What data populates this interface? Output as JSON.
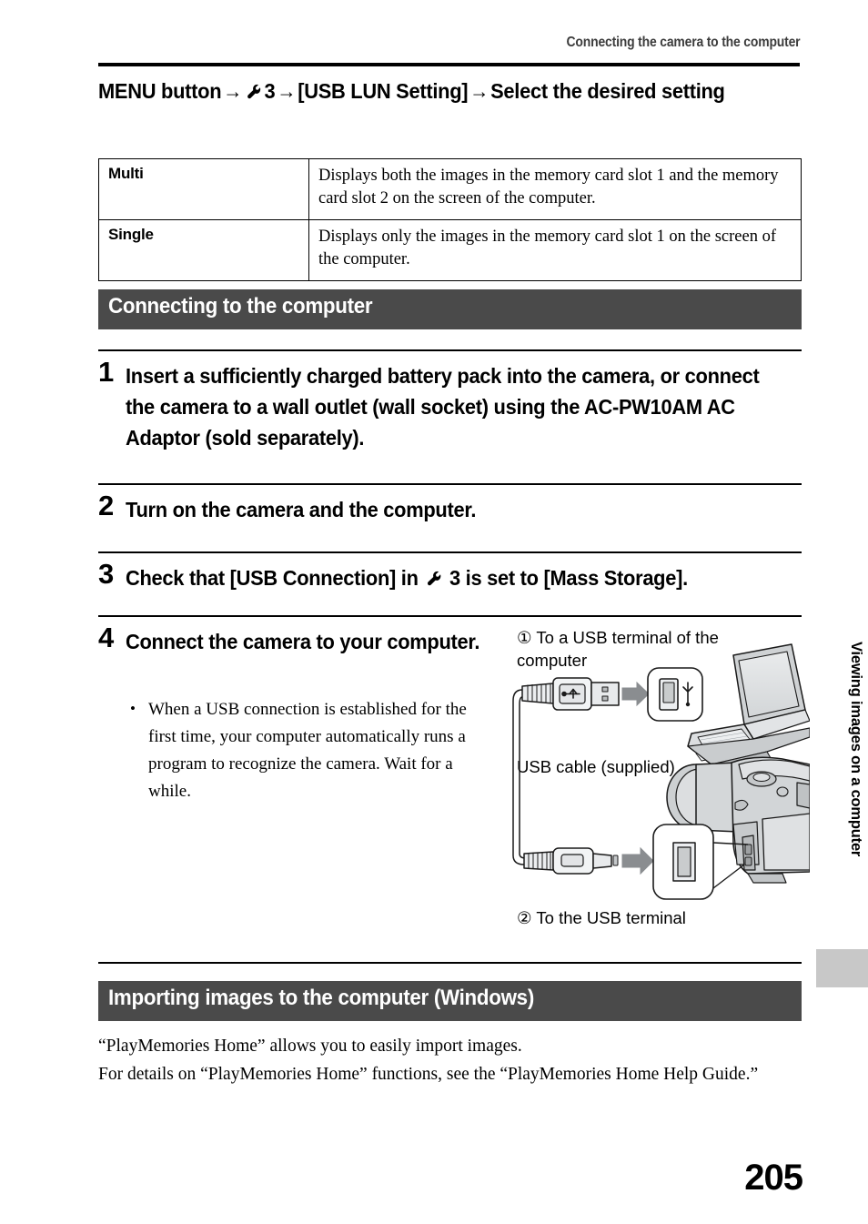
{
  "header": {
    "running_title": "Connecting the camera to the computer"
  },
  "menu_path": {
    "part1": "MENU button",
    "arrow1": "→",
    "icon": "wrench-icon",
    "tab_number": "3",
    "arrow2": "→",
    "part2": "[USB LUN Setting]",
    "arrow3": "→",
    "part3": "Select the desired setting"
  },
  "spec_table": {
    "rows": [
      {
        "term": "Multi",
        "desc": "Displays both the images in the memory card slot 1 and the memory card slot 2 on the screen of the computer."
      },
      {
        "term": "Single",
        "desc": "Displays only the images in the memory card slot 1 on the screen of the computer."
      }
    ]
  },
  "sections": {
    "connecting": {
      "heading": "Connecting to the computer",
      "steps": [
        {
          "number": "1",
          "text": "Insert a sufficiently charged battery pack into the camera, or connect the camera to a wall outlet (wall socket) using the AC-PW10AM AC Adaptor (sold separately)."
        },
        {
          "number": "2",
          "text": "Turn on the camera and the computer."
        },
        {
          "number": "3",
          "text_before": "Check that [USB Connection] in",
          "icon": "wrench-icon",
          "tab_number": "3",
          "text_after": "is set to [Mass Storage]."
        },
        {
          "number": "4",
          "text": "Connect the camera to your computer.",
          "bullets": [
            "When a USB connection is established for the first time, your computer automatically runs a program to recognize the camera. Wait for a while."
          ]
        }
      ]
    },
    "importing": {
      "heading": "Importing images to the computer (Windows)",
      "paragraphs": [
        "“PlayMemories Home” allows you to easily import images.",
        "For details on “PlayMemories Home” functions, see the “PlayMemories Home Help Guide.”"
      ]
    }
  },
  "figure": {
    "caption_top": "① To a USB terminal of the computer",
    "caption_cable": "USB cable (supplied)",
    "caption_bottom": "② To the USB terminal",
    "elements": {
      "laptop": "laptop-illustration",
      "camera": "camera-illustration",
      "usb_plug_a": "usb-type-a-plug-icon",
      "usb_plug_mini": "usb-mini-plug-icon",
      "usb_port_a": "usb-type-a-port-icon",
      "usb_port_mini": "usb-mini-port-icon"
    }
  },
  "side_tab": {
    "label": "Viewing images on a computer"
  },
  "page": {
    "number": "205"
  },
  "colors": {
    "section_bar": "#4a4a4a",
    "header_text": "#3c3c3c",
    "side_box": "#c8c8c8",
    "illustration_fill": "#d6d8da"
  }
}
